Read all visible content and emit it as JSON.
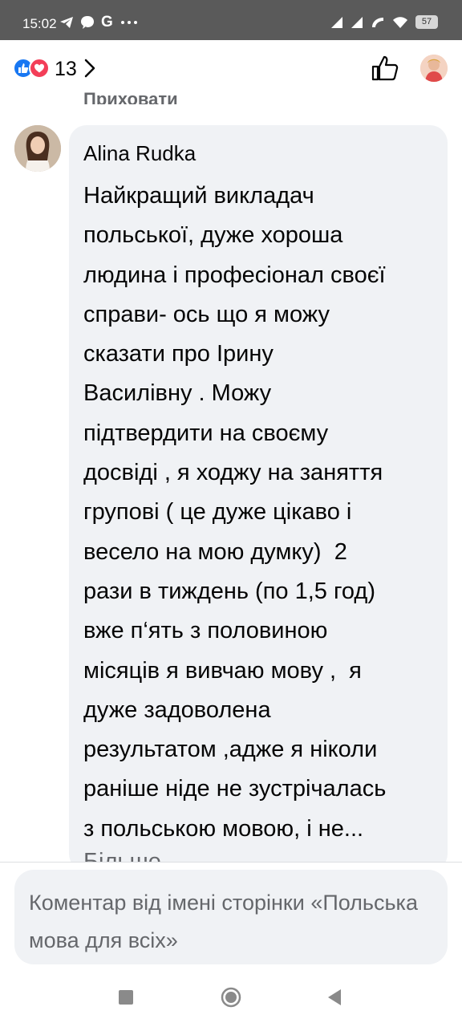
{
  "status_bar": {
    "time": "15:02",
    "left_icons": [
      "telegram-icon",
      "chat-icon",
      "google-icon",
      "more-icon"
    ],
    "google_letter": "G",
    "battery": "57"
  },
  "reactions": {
    "types": [
      "like",
      "love"
    ],
    "count": "13"
  },
  "colors": {
    "like_blue": "#1877f2",
    "love_red": "#f33e58",
    "bubble_bg": "#f0f2f5",
    "secondary_text": "#65676b",
    "status_bar_bg": "#5a5a5a"
  },
  "hide_link": "Приховати",
  "comment": {
    "author": "Alina Rudka",
    "text": "Найкращий викладач\nпольської, дуже хороша\nлюдина і професіонал своєї\nсправи- ось що я можу\nсказати про Ірину\nВасилівну . Можу\nпідтвердити на своєму\nдосвіді , я ходжу на заняття\nгрупові ( це дуже цікаво і\nвесело на мою думку)  2\nрази в тиждень (по 1,5 год)\nвже п‘ять з половиною\nмісяців я вивчаю мову ,  я\nдуже задоволена\nрезультатом ,адже я ніколи\nраніше ніде не зустрічалась\nз польською мовою, і не...",
    "more": "Більше"
  },
  "composer": {
    "placeholder": "Коментар від імені сторінки «Польська мова для всіх»"
  }
}
